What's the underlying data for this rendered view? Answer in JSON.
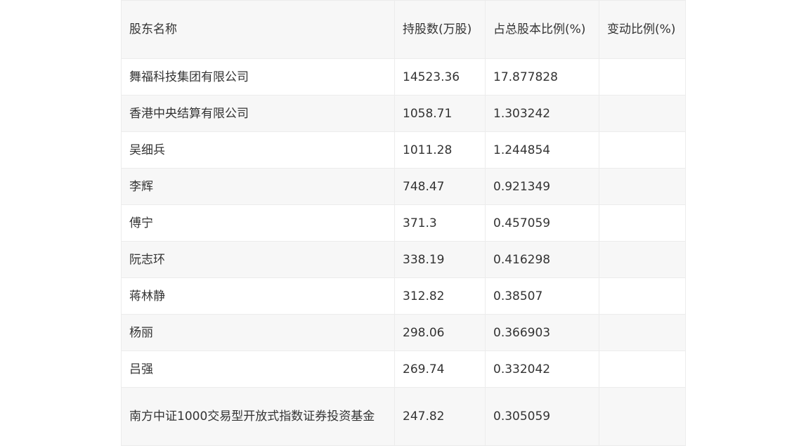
{
  "table": {
    "headers": [
      "股东名称",
      "持股数(万股)",
      "占总股本比例(%)",
      "变动比例(%)"
    ],
    "rows": [
      [
        "舞福科技集团有限公司",
        "14523.36",
        "17.877828",
        ""
      ],
      [
        "香港中央结算有限公司",
        "1058.71",
        "1.303242",
        ""
      ],
      [
        "吴细兵",
        "1011.28",
        "1.244854",
        ""
      ],
      [
        "李辉",
        "748.47",
        "0.921349",
        ""
      ],
      [
        "傅宁",
        "371.3",
        "0.457059",
        ""
      ],
      [
        "阮志环",
        "338.19",
        "0.416298",
        ""
      ],
      [
        "蒋林静",
        "312.82",
        "0.38507",
        ""
      ],
      [
        "杨丽",
        "298.06",
        "0.366903",
        ""
      ],
      [
        "吕强",
        "269.74",
        "0.332042",
        ""
      ],
      [
        "南方中证1000交易型开放式指数证券投资基金",
        "247.82",
        "0.305059",
        ""
      ]
    ]
  }
}
